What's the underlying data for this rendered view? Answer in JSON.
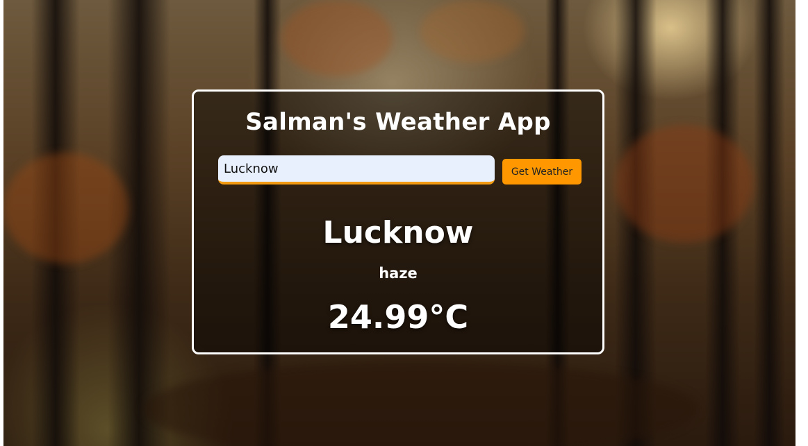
{
  "app": {
    "title": "Salman's Weather App"
  },
  "search": {
    "value": "Lucknow",
    "button_label": "Get Weather"
  },
  "weather": {
    "city": "Lucknow",
    "description": "haze",
    "temperature": "24.99°C"
  },
  "colors": {
    "accent": "#ff9800",
    "input_underline": "#f29a12",
    "input_background": "#e8f0fe",
    "card_border": "#ffffff",
    "text": "#ffffff"
  }
}
